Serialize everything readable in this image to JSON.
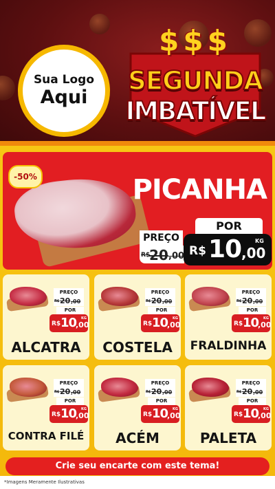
{
  "logo": {
    "line1": "Sua Logo",
    "line2": "Aqui"
  },
  "header": {
    "dollars": "$$$",
    "title_line1": "SEGUNDA",
    "title_line2": "IMBATÍVEL"
  },
  "featured": {
    "badge": "-50%",
    "name": "PICANHA",
    "preco_label": "PREÇO",
    "old_price": {
      "currency": "R$",
      "int": "20",
      "dec": ",00"
    },
    "por_label": "POR",
    "new_price": {
      "currency": "R$",
      "int": "10",
      "dec": ",00",
      "unit": "KG"
    }
  },
  "products": [
    {
      "name": "ALCATRA",
      "preco_label": "PREÇO",
      "old_price": {
        "currency": "R$",
        "int": "20",
        "dec": ",00"
      },
      "por_label": "POR",
      "new_price": {
        "currency": "R$",
        "int": "10",
        "dec": ",00",
        "unit": "KG"
      }
    },
    {
      "name": "COSTELA",
      "preco_label": "PREÇO",
      "old_price": {
        "currency": "R$",
        "int": "20",
        "dec": ",00"
      },
      "por_label": "POR",
      "new_price": {
        "currency": "R$",
        "int": "10",
        "dec": ",00",
        "unit": "KG"
      }
    },
    {
      "name": "FRALDINHA",
      "preco_label": "PREÇO",
      "old_price": {
        "currency": "R$",
        "int": "20",
        "dec": ",00"
      },
      "por_label": "POR",
      "new_price": {
        "currency": "R$",
        "int": "10",
        "dec": ",00",
        "unit": "KG"
      }
    },
    {
      "name": "CONTRA FILÉ",
      "preco_label": "PREÇO",
      "old_price": {
        "currency": "R$",
        "int": "20",
        "dec": ",00"
      },
      "por_label": "POR",
      "new_price": {
        "currency": "R$",
        "int": "10",
        "dec": ",00",
        "unit": "KG"
      }
    },
    {
      "name": "ACÉM",
      "preco_label": "PREÇO",
      "old_price": {
        "currency": "R$",
        "int": "20",
        "dec": ",00"
      },
      "por_label": "POR",
      "new_price": {
        "currency": "R$",
        "int": "10",
        "dec": ",00",
        "unit": "KG"
      }
    },
    {
      "name": "PALETA",
      "preco_label": "PREÇO",
      "old_price": {
        "currency": "R$",
        "int": "20",
        "dec": ",00"
      },
      "por_label": "POR",
      "new_price": {
        "currency": "R$",
        "int": "10",
        "dec": ",00",
        "unit": "KG"
      }
    }
  ],
  "cta": "Crie seu encarte com este tema!",
  "footnote": "*Imagens Meramente Ilustrativas",
  "colors": {
    "header_red": "#5c0f10",
    "background_yellow": "#f7c714",
    "accent_red": "#e21e22",
    "price_black": "#0d0d0d",
    "logo_ring": "#f6b800"
  }
}
